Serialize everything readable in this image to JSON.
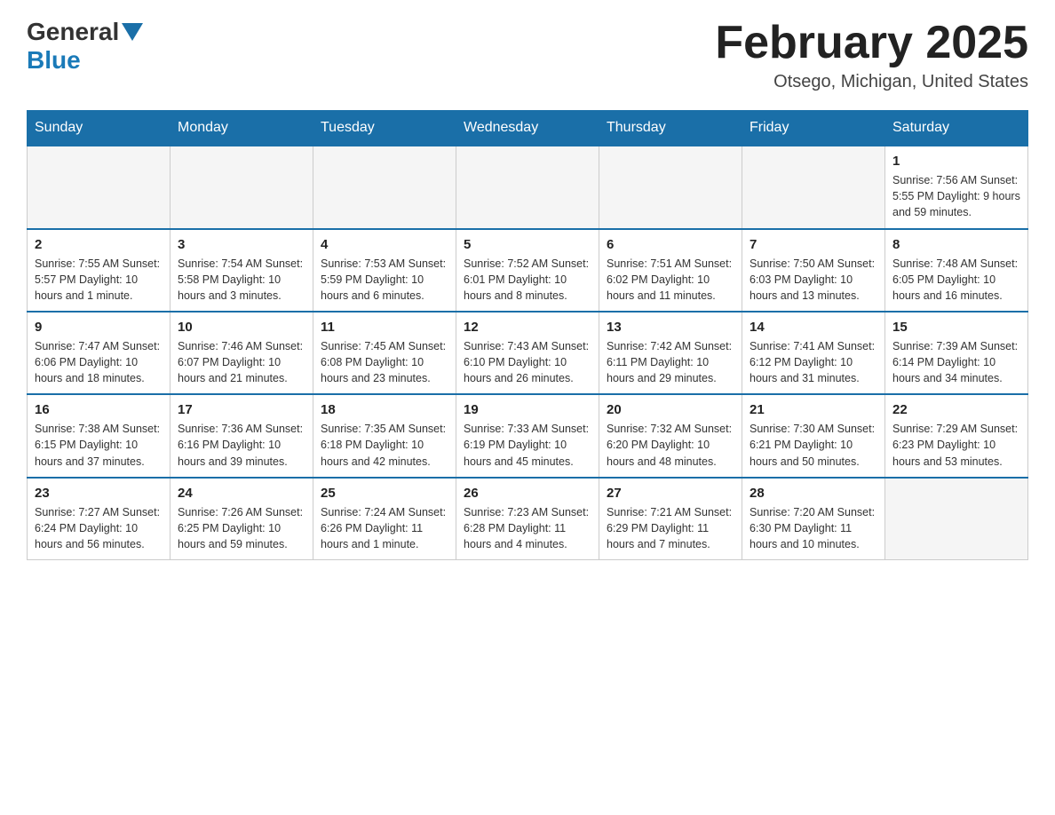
{
  "header": {
    "logo_general": "General",
    "logo_blue": "Blue",
    "month_title": "February 2025",
    "location": "Otsego, Michigan, United States"
  },
  "days_of_week": [
    "Sunday",
    "Monday",
    "Tuesday",
    "Wednesday",
    "Thursday",
    "Friday",
    "Saturday"
  ],
  "weeks": [
    [
      {
        "day": "",
        "info": ""
      },
      {
        "day": "",
        "info": ""
      },
      {
        "day": "",
        "info": ""
      },
      {
        "day": "",
        "info": ""
      },
      {
        "day": "",
        "info": ""
      },
      {
        "day": "",
        "info": ""
      },
      {
        "day": "1",
        "info": "Sunrise: 7:56 AM\nSunset: 5:55 PM\nDaylight: 9 hours and 59 minutes."
      }
    ],
    [
      {
        "day": "2",
        "info": "Sunrise: 7:55 AM\nSunset: 5:57 PM\nDaylight: 10 hours and 1 minute."
      },
      {
        "day": "3",
        "info": "Sunrise: 7:54 AM\nSunset: 5:58 PM\nDaylight: 10 hours and 3 minutes."
      },
      {
        "day": "4",
        "info": "Sunrise: 7:53 AM\nSunset: 5:59 PM\nDaylight: 10 hours and 6 minutes."
      },
      {
        "day": "5",
        "info": "Sunrise: 7:52 AM\nSunset: 6:01 PM\nDaylight: 10 hours and 8 minutes."
      },
      {
        "day": "6",
        "info": "Sunrise: 7:51 AM\nSunset: 6:02 PM\nDaylight: 10 hours and 11 minutes."
      },
      {
        "day": "7",
        "info": "Sunrise: 7:50 AM\nSunset: 6:03 PM\nDaylight: 10 hours and 13 minutes."
      },
      {
        "day": "8",
        "info": "Sunrise: 7:48 AM\nSunset: 6:05 PM\nDaylight: 10 hours and 16 minutes."
      }
    ],
    [
      {
        "day": "9",
        "info": "Sunrise: 7:47 AM\nSunset: 6:06 PM\nDaylight: 10 hours and 18 minutes."
      },
      {
        "day": "10",
        "info": "Sunrise: 7:46 AM\nSunset: 6:07 PM\nDaylight: 10 hours and 21 minutes."
      },
      {
        "day": "11",
        "info": "Sunrise: 7:45 AM\nSunset: 6:08 PM\nDaylight: 10 hours and 23 minutes."
      },
      {
        "day": "12",
        "info": "Sunrise: 7:43 AM\nSunset: 6:10 PM\nDaylight: 10 hours and 26 minutes."
      },
      {
        "day": "13",
        "info": "Sunrise: 7:42 AM\nSunset: 6:11 PM\nDaylight: 10 hours and 29 minutes."
      },
      {
        "day": "14",
        "info": "Sunrise: 7:41 AM\nSunset: 6:12 PM\nDaylight: 10 hours and 31 minutes."
      },
      {
        "day": "15",
        "info": "Sunrise: 7:39 AM\nSunset: 6:14 PM\nDaylight: 10 hours and 34 minutes."
      }
    ],
    [
      {
        "day": "16",
        "info": "Sunrise: 7:38 AM\nSunset: 6:15 PM\nDaylight: 10 hours and 37 minutes."
      },
      {
        "day": "17",
        "info": "Sunrise: 7:36 AM\nSunset: 6:16 PM\nDaylight: 10 hours and 39 minutes."
      },
      {
        "day": "18",
        "info": "Sunrise: 7:35 AM\nSunset: 6:18 PM\nDaylight: 10 hours and 42 minutes."
      },
      {
        "day": "19",
        "info": "Sunrise: 7:33 AM\nSunset: 6:19 PM\nDaylight: 10 hours and 45 minutes."
      },
      {
        "day": "20",
        "info": "Sunrise: 7:32 AM\nSunset: 6:20 PM\nDaylight: 10 hours and 48 minutes."
      },
      {
        "day": "21",
        "info": "Sunrise: 7:30 AM\nSunset: 6:21 PM\nDaylight: 10 hours and 50 minutes."
      },
      {
        "day": "22",
        "info": "Sunrise: 7:29 AM\nSunset: 6:23 PM\nDaylight: 10 hours and 53 minutes."
      }
    ],
    [
      {
        "day": "23",
        "info": "Sunrise: 7:27 AM\nSunset: 6:24 PM\nDaylight: 10 hours and 56 minutes."
      },
      {
        "day": "24",
        "info": "Sunrise: 7:26 AM\nSunset: 6:25 PM\nDaylight: 10 hours and 59 minutes."
      },
      {
        "day": "25",
        "info": "Sunrise: 7:24 AM\nSunset: 6:26 PM\nDaylight: 11 hours and 1 minute."
      },
      {
        "day": "26",
        "info": "Sunrise: 7:23 AM\nSunset: 6:28 PM\nDaylight: 11 hours and 4 minutes."
      },
      {
        "day": "27",
        "info": "Sunrise: 7:21 AM\nSunset: 6:29 PM\nDaylight: 11 hours and 7 minutes."
      },
      {
        "day": "28",
        "info": "Sunrise: 7:20 AM\nSunset: 6:30 PM\nDaylight: 11 hours and 10 minutes."
      },
      {
        "day": "",
        "info": ""
      }
    ]
  ]
}
